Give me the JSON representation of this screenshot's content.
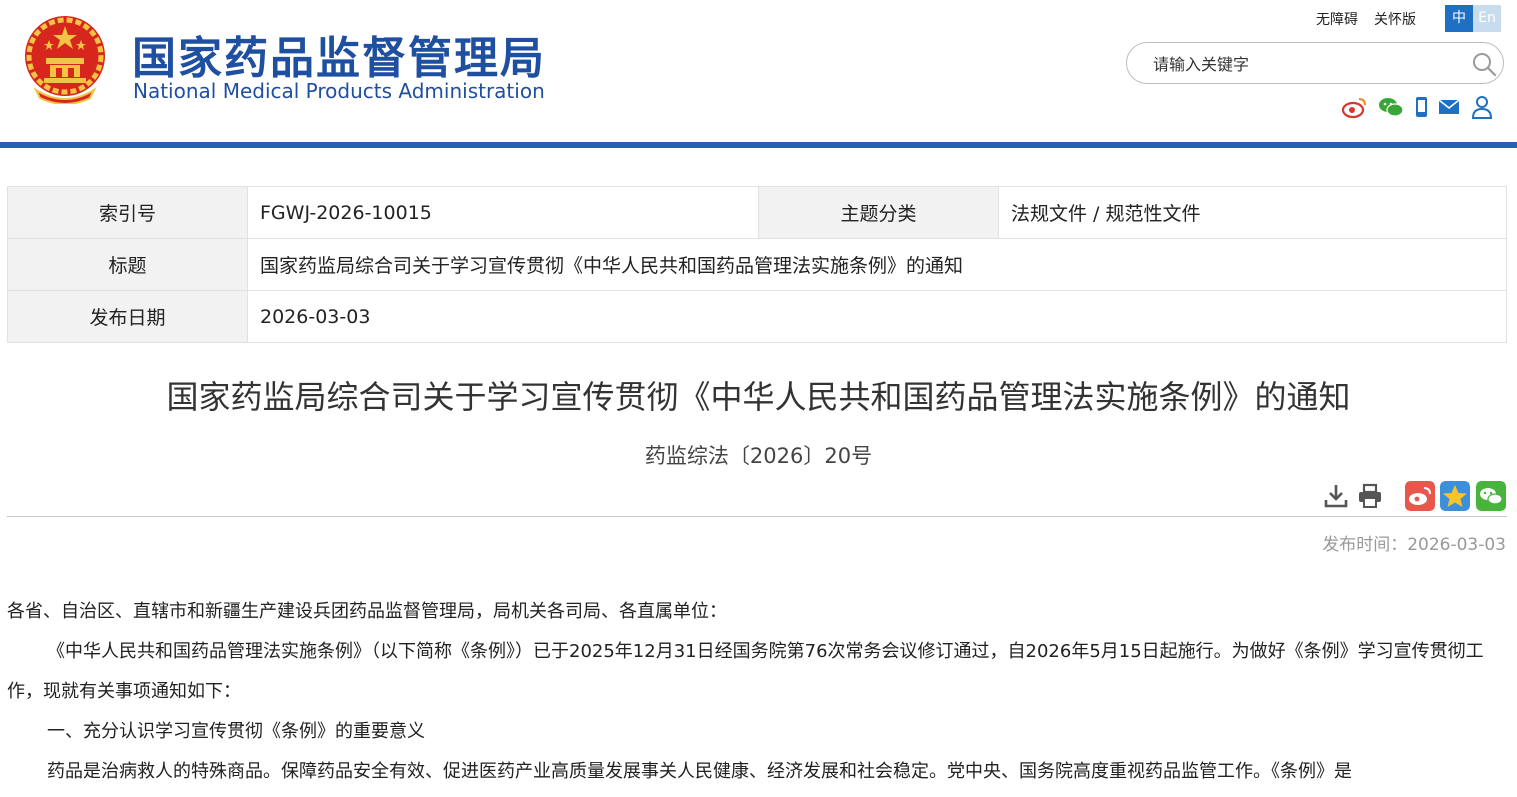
{
  "header": {
    "site_title_cn": "国家药品监督管理局",
    "site_title_en": "National Medical Products Administration",
    "accessibility": "无障碍",
    "elderly_mode": "关怀版",
    "lang_zh": "中",
    "lang_en": "En",
    "search_placeholder": "请输入关键字",
    "social_icons": [
      "weibo-icon",
      "wechat-icon",
      "mobile-icon",
      "mail-icon",
      "user-icon"
    ],
    "colors": {
      "brand": "#1f4fa0",
      "bar": "#2a5fb0",
      "emblem_red": "#d7261e",
      "emblem_gold": "#f3c343"
    }
  },
  "meta": {
    "index_label": "索引号",
    "index_value": "FGWJ-2026-10015",
    "category_label": "主题分类",
    "category_value": "法规文件 / 规范性文件",
    "title_label": "标题",
    "title_value": "国家药监局综合司关于学习宣传贯彻《中华人民共和国药品管理法实施条例》的通知",
    "date_label": "发布日期",
    "date_value": "2026-03-03"
  },
  "article": {
    "title": "国家药监局综合司关于学习宣传贯彻《中华人民共和国药品管理法实施条例》的通知",
    "doc_number": "药监综法〔2026〕20号",
    "publish_time": "发布时间：2026-03-03",
    "tools": [
      "download-icon",
      "print-icon"
    ],
    "share_icons": [
      "weibo-share-icon",
      "qzone-share-icon",
      "wechat-share-icon"
    ],
    "paragraphs": [
      "各省、自治区、直辖市和新疆生产建设兵团药品监督管理局，局机关各司局、各直属单位：",
      "《中华人民共和国药品管理法实施条例》（以下简称《条例》）已于2025年12月31日经国务院第76次常务会议修订通过，自2026年5月15日起施行。为做好《条例》学习宣传贯彻工作，现就有关事项通知如下：",
      "一、充分认识学习宣传贯彻《条例》的重要意义",
      "药品是治病救人的特殊商品。保障药品安全有效、促进医药产业高质量发展事关人民健康、经济发展和社会稳定。党中央、国务院高度重视药品监管工作。《条例》是"
    ]
  }
}
